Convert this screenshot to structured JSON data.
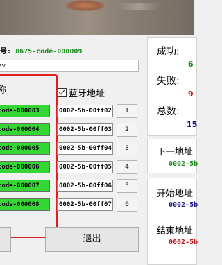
{
  "header": {
    "code_label": "号:",
    "code_value": "8675-code-000009"
  },
  "textbox": {
    "value": "ev"
  },
  "group": {
    "title": "称",
    "bt_checkbox_label": "蓝牙地址",
    "bt_checked": true
  },
  "rows": [
    {
      "code": "code-000003",
      "mac": "0002-5b-00ff02",
      "index": "1"
    },
    {
      "code": "code-000004",
      "mac": "0002-5b-00ff03",
      "index": "2"
    },
    {
      "code": "code-000005",
      "mac": "0002-5b-00ff04",
      "index": "3"
    },
    {
      "code": "code-000006",
      "mac": "0002-5b-00ff05",
      "index": "4"
    },
    {
      "code": "code-000007",
      "mac": "0002-5b-00ff06",
      "index": "5"
    },
    {
      "code": "code-000008",
      "mac": "0002-5b-00ff07",
      "index": "6"
    }
  ],
  "buttons": {
    "exit": "退出"
  },
  "stats": {
    "success_label": "成功:",
    "success_value": "6",
    "fail_label": "失败:",
    "fail_value": "9",
    "total_label": "总数:",
    "total_value": "15"
  },
  "next": {
    "title": "下一地址",
    "value": "0002-5b"
  },
  "range": {
    "start_title": "开始地址",
    "start_value": "0002-5b",
    "end_title": "结束地址",
    "end_value": "0002-5b"
  },
  "colors": {
    "code_green": "#1a8a1a",
    "field_green": "#35d735",
    "highlight_red": "#e02020",
    "success_green": "#1f8a1f",
    "fail_red": "#d01515",
    "total_blue": "#101080",
    "next_green": "#1f8a1f",
    "start_blue": "#1a1a90",
    "end_red": "#c01515"
  }
}
